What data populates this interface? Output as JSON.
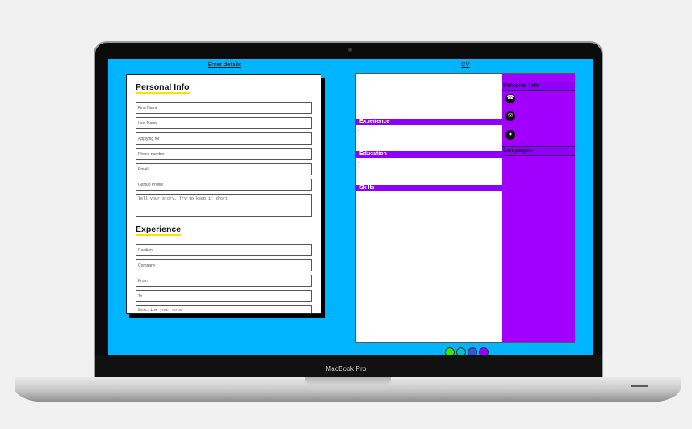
{
  "nav": {
    "enter_details": "Enter details",
    "cv": "CV"
  },
  "form": {
    "personal_title": "Personal Info",
    "fields": [
      "First Name",
      "Last Name",
      "Applying for",
      "Phone number",
      "Email",
      "GitHub Profile"
    ],
    "story_placeholder": "Tell your story. Try to keep it short!",
    "experience_title": "Experience",
    "exp_fields": [
      "Position",
      "Company",
      "From",
      "To"
    ],
    "role_placeholder": "Describe your role"
  },
  "cv": {
    "experience": "Experience",
    "education": "Education",
    "skills": "Skills",
    "dash": "-",
    "side_personal": "Personal Info",
    "side_languages": "Languages",
    "icons": [
      "phone-icon",
      "email-icon",
      "github-icon"
    ]
  },
  "theme_colors": [
    "#39e600",
    "#00c2c2",
    "#3355dd",
    "#9b00ff"
  ],
  "device": {
    "label": "MacBook Pro"
  },
  "colors": {
    "screen": "#00b4ff",
    "band": "#8e00f7",
    "sidebar": "#a100ff",
    "underline": "#ffe100"
  }
}
